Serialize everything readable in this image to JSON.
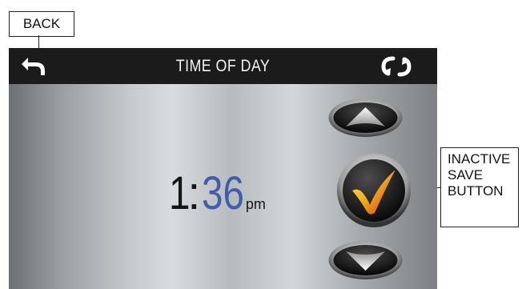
{
  "callouts": {
    "back": "BACK",
    "save_lines": [
      "INACTIVE",
      "SAVE",
      "BUTTON"
    ]
  },
  "header": {
    "title": "TIME OF DAY"
  },
  "time": {
    "hour": "1",
    "separator": ":",
    "minutes": "36",
    "ampm": "pm"
  },
  "icons": {
    "back": "back-arrow-icon",
    "refresh": "refresh-icon",
    "up": "up-arrow-icon",
    "save": "checkmark-icon",
    "down": "down-arrow-icon"
  },
  "colors": {
    "minutes": "#3d5fae",
    "header_bg": "#1b1b1b",
    "check_accent": "#f2b21a"
  }
}
